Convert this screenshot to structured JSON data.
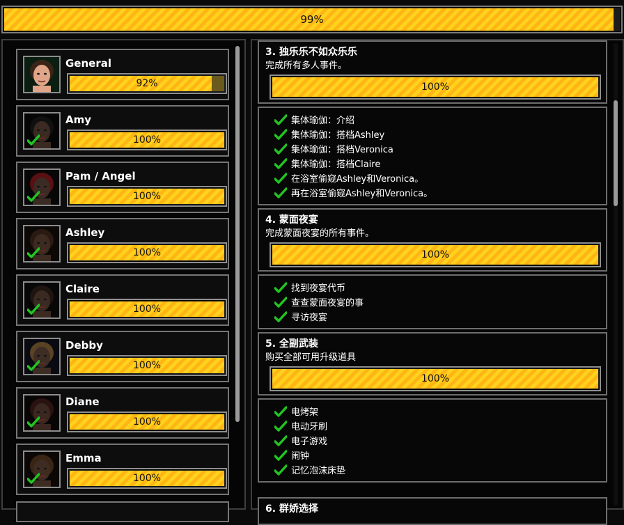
{
  "overall": {
    "label": "99%",
    "value": 0.99
  },
  "characters": [
    {
      "name": "General",
      "progress_label": "92%",
      "progress": 0.92,
      "completed": false,
      "skin": "#e0a588",
      "hair": "#3a2418",
      "bg": "#0b1e12"
    },
    {
      "name": "Amy",
      "progress_label": "100%",
      "progress": 1.0,
      "completed": true,
      "skin": "#3a2a22",
      "hair": "#101010",
      "bg": "#050505"
    },
    {
      "name": "Pam / Angel",
      "progress_label": "100%",
      "progress": 1.0,
      "completed": true,
      "skin": "#3b2b25",
      "hair": "#5a0f12",
      "bg": "#070707"
    },
    {
      "name": "Ashley",
      "progress_label": "100%",
      "progress": 1.0,
      "completed": true,
      "skin": "#3d2b22",
      "hair": "#2a1a12",
      "bg": "#0c0806"
    },
    {
      "name": "Claire",
      "progress_label": "100%",
      "progress": 1.0,
      "completed": true,
      "skin": "#3a2a22",
      "hair": "#1e1410",
      "bg": "#070707"
    },
    {
      "name": "Debby",
      "progress_label": "100%",
      "progress": 1.0,
      "completed": true,
      "skin": "#3d2d24",
      "hair": "#5a4224",
      "bg": "#0a0a12"
    },
    {
      "name": "Diane",
      "progress_label": "100%",
      "progress": 1.0,
      "completed": true,
      "skin": "#3a2720",
      "hair": "#2a1210",
      "bg": "#080505"
    },
    {
      "name": "Emma",
      "progress_label": "100%",
      "progress": 1.0,
      "completed": true,
      "skin": "#3e2c22",
      "hair": "#3a2414",
      "bg": "#0a0705"
    }
  ],
  "achievements": [
    {
      "title": "3. 独乐乐不如众乐乐",
      "desc": "完成所有多人事件。",
      "progress_label": "100%",
      "progress": 1.0,
      "subs": [
        "集体瑜伽：介绍",
        "集体瑜伽：搭档Ashley",
        "集体瑜伽：搭档Veronica",
        "集体瑜伽：搭档Claire",
        "在浴室偷窥Ashley和Veronica。",
        "再在浴室偷窥Ashley和Veronica。"
      ]
    },
    {
      "title": "4. 蒙面夜宴",
      "desc": "完成蒙面夜宴的所有事件。",
      "progress_label": "100%",
      "progress": 1.0,
      "subs": [
        "找到夜宴代币",
        "查查蒙面夜宴的事",
        "寻访夜宴"
      ]
    },
    {
      "title": "5. 全副武装",
      "desc": "购买全部可用升级道具",
      "progress_label": "100%",
      "progress": 1.0,
      "subs": [
        "电烤架",
        "电动牙刷",
        "电子游戏",
        "闹钟",
        "记忆泡沫床垫"
      ]
    }
  ],
  "next_partial_title": "6. 群娇选择",
  "colors": {
    "check": "#22c522",
    "bar_a": "#ffd21c",
    "bar_b": "#ffb515",
    "frame": "#8f8f8f"
  }
}
